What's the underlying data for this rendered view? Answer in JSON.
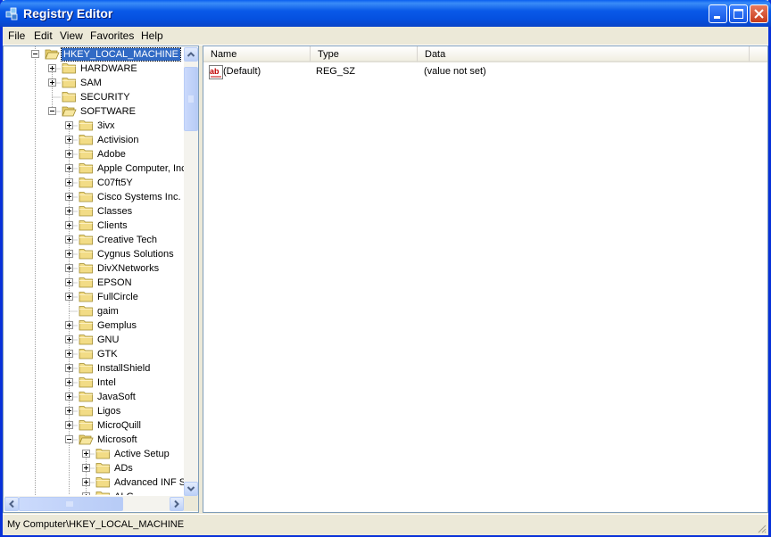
{
  "window": {
    "title": "Registry Editor"
  },
  "menu": [
    "File",
    "Edit",
    "View",
    "Favorites",
    "Help"
  ],
  "tree": [
    {
      "label": "HKEY_LOCAL_MACHINE",
      "level": 1,
      "expander": "minus",
      "open": true,
      "selected": true
    },
    {
      "label": "HARDWARE",
      "level": 2,
      "expander": "plus"
    },
    {
      "label": "SAM",
      "level": 2,
      "expander": "plus"
    },
    {
      "label": "SECURITY",
      "level": 2,
      "expander": "none"
    },
    {
      "label": "SOFTWARE",
      "level": 2,
      "expander": "minus",
      "open": true
    },
    {
      "label": "3ivx",
      "level": 3,
      "expander": "plus"
    },
    {
      "label": "Activision",
      "level": 3,
      "expander": "plus"
    },
    {
      "label": "Adobe",
      "level": 3,
      "expander": "plus"
    },
    {
      "label": "Apple Computer, Inc.",
      "level": 3,
      "expander": "plus"
    },
    {
      "label": "C07ft5Y",
      "level": 3,
      "expander": "plus"
    },
    {
      "label": "Cisco Systems Inc.",
      "level": 3,
      "expander": "plus"
    },
    {
      "label": "Classes",
      "level": 3,
      "expander": "plus"
    },
    {
      "label": "Clients",
      "level": 3,
      "expander": "plus"
    },
    {
      "label": "Creative Tech",
      "level": 3,
      "expander": "plus"
    },
    {
      "label": "Cygnus Solutions",
      "level": 3,
      "expander": "plus"
    },
    {
      "label": "DivXNetworks",
      "level": 3,
      "expander": "plus"
    },
    {
      "label": "EPSON",
      "level": 3,
      "expander": "plus"
    },
    {
      "label": "FullCircle",
      "level": 3,
      "expander": "plus"
    },
    {
      "label": "gaim",
      "level": 3,
      "expander": "none"
    },
    {
      "label": "Gemplus",
      "level": 3,
      "expander": "plus"
    },
    {
      "label": "GNU",
      "level": 3,
      "expander": "plus"
    },
    {
      "label": "GTK",
      "level": 3,
      "expander": "plus"
    },
    {
      "label": "InstallShield",
      "level": 3,
      "expander": "plus"
    },
    {
      "label": "Intel",
      "level": 3,
      "expander": "plus"
    },
    {
      "label": "JavaSoft",
      "level": 3,
      "expander": "plus"
    },
    {
      "label": "Ligos",
      "level": 3,
      "expander": "plus"
    },
    {
      "label": "MicroQuill",
      "level": 3,
      "expander": "plus"
    },
    {
      "label": "Microsoft",
      "level": 3,
      "expander": "minus",
      "open": true
    },
    {
      "label": "Active Setup",
      "level": 4,
      "expander": "plus"
    },
    {
      "label": "ADs",
      "level": 4,
      "expander": "plus"
    },
    {
      "label": "Advanced INF Setup",
      "level": 4,
      "expander": "plus"
    },
    {
      "label": "ALG",
      "level": 4,
      "expander": "plus"
    }
  ],
  "columns": {
    "name": "Name",
    "type": "Type",
    "data": "Data"
  },
  "values": [
    {
      "icon": "string-value-icon",
      "name": "(Default)",
      "type": "REG_SZ",
      "data": "(value not set)"
    }
  ],
  "status": {
    "path": "My Computer\\HKEY_LOCAL_MACHINE"
  }
}
